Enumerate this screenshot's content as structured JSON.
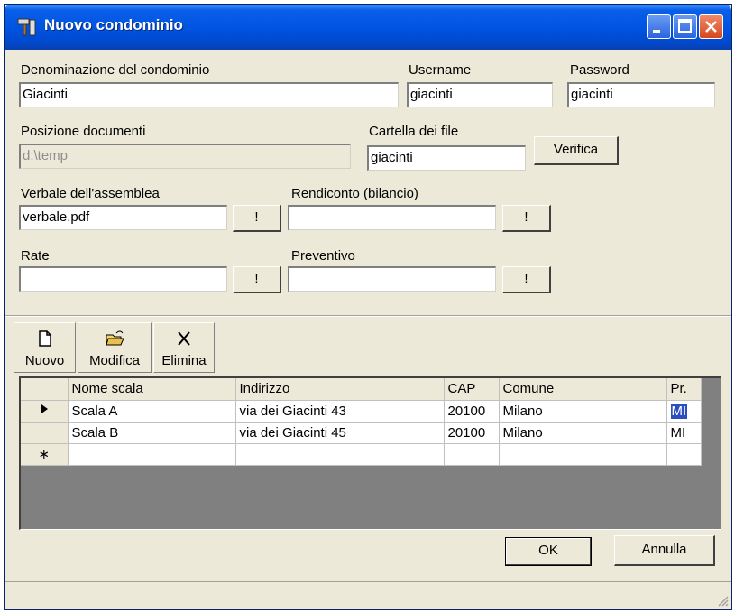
{
  "window": {
    "title": "Nuovo condominio"
  },
  "fields": {
    "denominazione": {
      "label": "Denominazione del condominio",
      "value": "Giacinti"
    },
    "username": {
      "label": "Username",
      "value": "giacinti"
    },
    "password": {
      "label": "Password",
      "value": "giacinti"
    },
    "posizione": {
      "label": "Posizione documenti",
      "value": "d:\\temp"
    },
    "cartella": {
      "label": "Cartella dei file",
      "value": "giacinti"
    },
    "verifica_label": "Verifica",
    "verbale": {
      "label": "Verbale dell'assemblea",
      "value": "verbale.pdf"
    },
    "rendiconto": {
      "label": "Rendiconto (bilancio)",
      "value": ""
    },
    "rate": {
      "label": "Rate",
      "value": ""
    },
    "preventivo": {
      "label": "Preventivo",
      "value": ""
    },
    "browse_label": "!"
  },
  "toolbar": {
    "nuovo": "Nuovo",
    "modifica": "Modifica",
    "elimina": "Elimina"
  },
  "grid": {
    "columns": [
      "Nome scala",
      "Indirizzo",
      "CAP",
      "Comune",
      "Pr."
    ],
    "rows": [
      {
        "nome": "Scala A",
        "indirizzo": "via dei Giacinti 43",
        "cap": "20100",
        "comune": "Milano",
        "pr": "MI"
      },
      {
        "nome": "Scala B",
        "indirizzo": "via dei Giacinti 45",
        "cap": "20100",
        "comune": "Milano",
        "pr": "MI"
      }
    ],
    "new_row_marker": "∗"
  },
  "buttons": {
    "ok": "OK",
    "annulla": "Annulla"
  }
}
